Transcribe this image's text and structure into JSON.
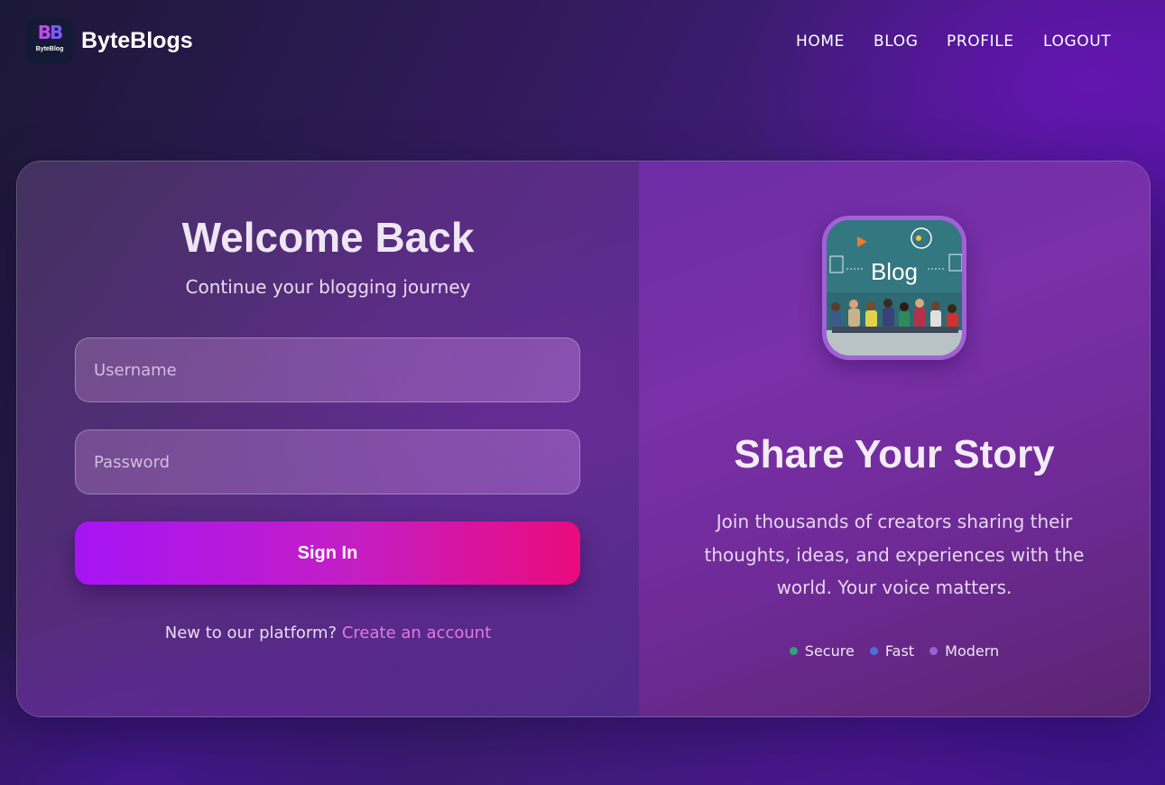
{
  "header": {
    "logo_text": "ByteBlog",
    "logo_glyph_left": "B",
    "logo_glyph_right": "B",
    "brand": "ByteBlogs",
    "nav": {
      "home": "HOME",
      "blog": "BLOG",
      "profile": "PROFILE",
      "logout": "LOGOUT"
    }
  },
  "login": {
    "title": "Welcome Back",
    "subtitle": "Continue your blogging journey",
    "username_placeholder": "Username",
    "password_placeholder": "Password",
    "signin_label": "Sign In",
    "signup_prompt": "New to our platform?",
    "signup_link": "Create an account"
  },
  "promo": {
    "image_caption": "Blog",
    "title": "Share Your Story",
    "description": "Join thousands of creators sharing their thoughts, ideas, and experiences with the world. Your voice matters.",
    "features": [
      {
        "label": "Secure",
        "color": "#2fa37a"
      },
      {
        "label": "Fast",
        "color": "#4a6fd8"
      },
      {
        "label": "Modern",
        "color": "#9b5fd6"
      }
    ]
  },
  "colors": {
    "accent_start": "#a614f5",
    "accent_end": "#ea0b7c",
    "link": "#e27ae2"
  }
}
